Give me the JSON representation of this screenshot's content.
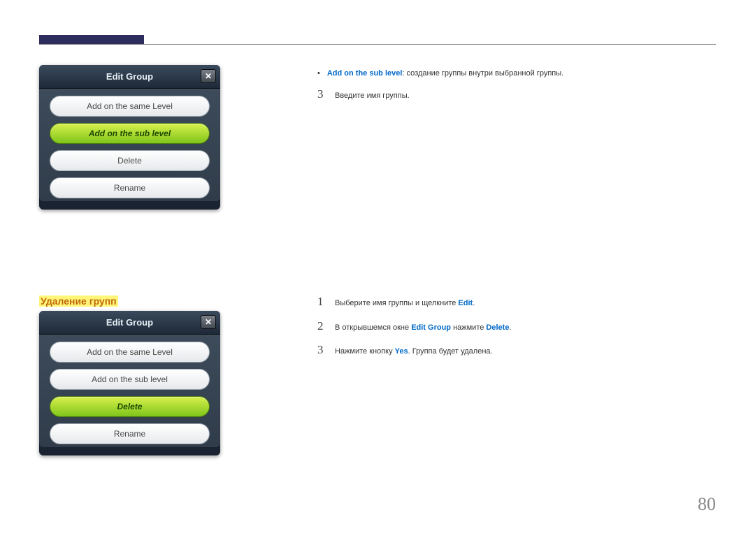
{
  "dialog1": {
    "title": "Edit Group",
    "items": [
      "Add on the same Level",
      "Add on the sub level",
      "Delete",
      "Rename"
    ],
    "selected_index": 1
  },
  "dialog2": {
    "title": "Edit Group",
    "items": [
      "Add on the same Level",
      "Add on the sub level",
      "Delete",
      "Rename"
    ],
    "selected_index": 2
  },
  "section_heading": "Удаление групп",
  "top_bullets": [
    {
      "hl": "Add on the sub level",
      "text": ": создание группы внутри выбранной группы."
    }
  ],
  "top_steps": [
    {
      "n": "3",
      "parts": [
        {
          "t": "Введите имя группы."
        }
      ]
    }
  ],
  "bottom_steps": [
    {
      "n": "1",
      "parts": [
        {
          "t": "Выберите имя группы и щелкните "
        },
        {
          "t": "Edit",
          "hl": true
        },
        {
          "t": "."
        }
      ]
    },
    {
      "n": "2",
      "parts": [
        {
          "t": "В открывшемся окне "
        },
        {
          "t": "Edit Group",
          "hl": true
        },
        {
          "t": " нажмите "
        },
        {
          "t": "Delete",
          "hl": true
        },
        {
          "t": "."
        }
      ]
    },
    {
      "n": "3",
      "parts": [
        {
          "t": "Нажмите кнопку "
        },
        {
          "t": "Yes",
          "hl": true
        },
        {
          "t": ". Группа будет удалена."
        }
      ]
    }
  ],
  "page_number": "80",
  "close_glyph": "✕"
}
